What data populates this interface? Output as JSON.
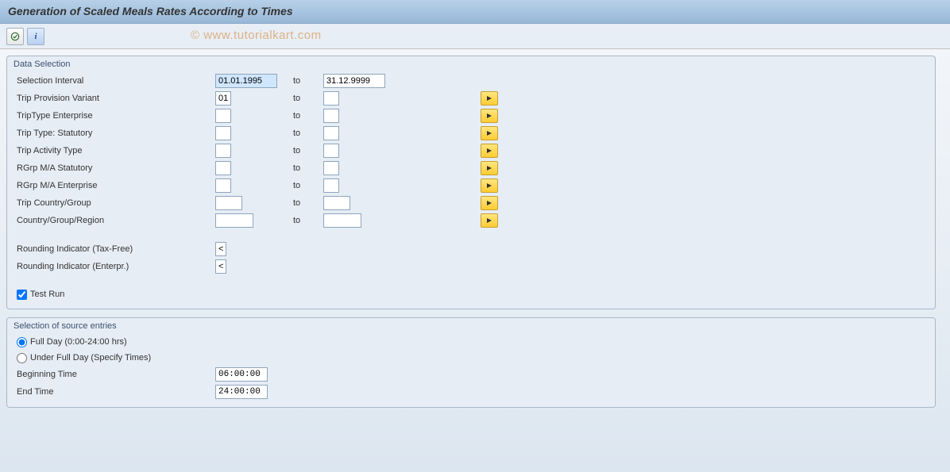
{
  "title": "Generation of Scaled Meals Rates According to Times",
  "watermark": "© www.tutorialkart.com",
  "group1": {
    "title": "Data Selection",
    "rows": {
      "interval": {
        "label": "Selection Interval",
        "from": "01.01.1995",
        "to": "31.12.9999",
        "to_label": "to"
      },
      "variant": {
        "label": "Trip Provision Variant",
        "from": "01",
        "to": "",
        "to_label": "to"
      },
      "ent": {
        "label": "TripType Enterprise",
        "from": "",
        "to": "",
        "to_label": "to"
      },
      "stat": {
        "label": "Trip Type: Statutory",
        "from": "",
        "to": "",
        "to_label": "to"
      },
      "act": {
        "label": "Trip Activity Type",
        "from": "",
        "to": "",
        "to_label": "to"
      },
      "rstat": {
        "label": "RGrp M/A Statutory",
        "from": "",
        "to": "",
        "to_label": "to"
      },
      "rent": {
        "label": "RGrp M/A Enterprise",
        "from": "",
        "to": "",
        "to_label": "to"
      },
      "cgroup": {
        "label": "Trip Country/Group",
        "from": "",
        "to": "",
        "to_label": "to"
      },
      "region": {
        "label": "Country/Group/Region",
        "from": "",
        "to": "",
        "to_label": "to"
      },
      "round1": {
        "label": "Rounding Indicator (Tax-Free)",
        "val": "<"
      },
      "round2": {
        "label": "Rounding Indicator (Enterpr.)",
        "val": "<"
      },
      "testrun": {
        "label": "Test Run"
      }
    }
  },
  "group2": {
    "title": "Selection of source entries",
    "radio1": "Full Day (0:00-24:00 hrs)",
    "radio2": "Under Full Day (Specify Times)",
    "begin": {
      "label": "Beginning Time",
      "val": "06:00:00"
    },
    "end": {
      "label": "End Time",
      "val": "24:00:00"
    }
  }
}
